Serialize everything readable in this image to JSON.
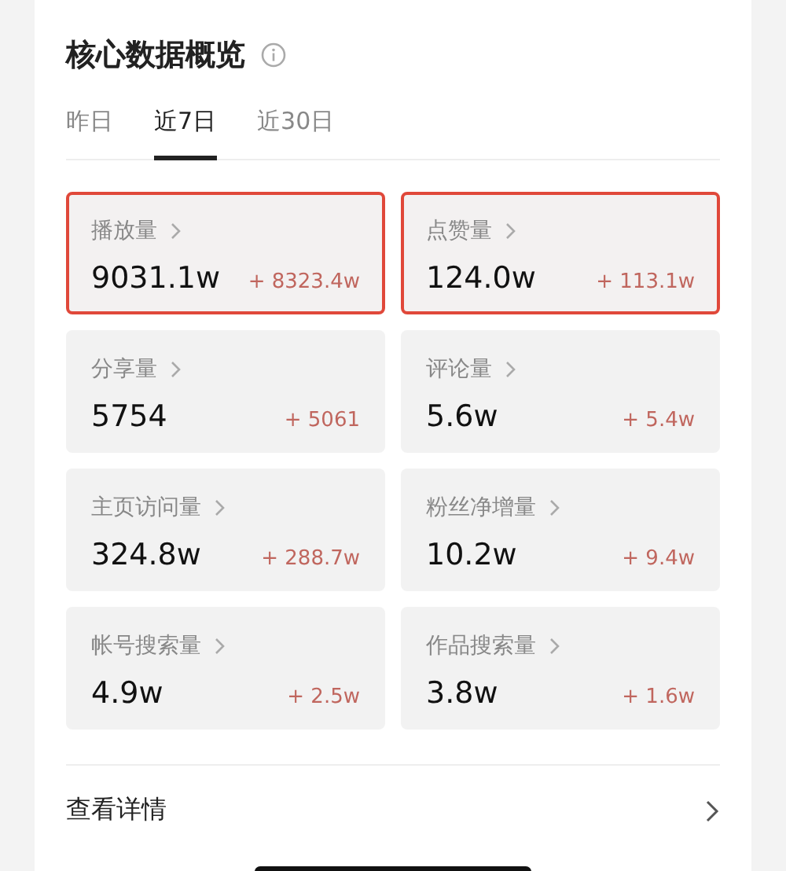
{
  "title": "核心数据概览",
  "tabs": [
    {
      "label": "昨日",
      "selected": false
    },
    {
      "label": "近7日",
      "selected": true
    },
    {
      "label": "近30日",
      "selected": false
    }
  ],
  "metrics": [
    {
      "label": "播放量",
      "value": "9031.1w",
      "change": "+ 8323.4w",
      "highlighted": true
    },
    {
      "label": "点赞量",
      "value": "124.0w",
      "change": "+ 113.1w",
      "highlighted": true
    },
    {
      "label": "分享量",
      "value": "5754",
      "change": "+ 5061",
      "highlighted": false
    },
    {
      "label": "评论量",
      "value": "5.6w",
      "change": "+ 5.4w",
      "highlighted": false
    },
    {
      "label": "主页访问量",
      "value": "324.8w",
      "change": "+ 288.7w",
      "highlighted": false
    },
    {
      "label": "粉丝净增量",
      "value": "10.2w",
      "change": "+ 9.4w",
      "highlighted": false
    },
    {
      "label": "帐号搜索量",
      "value": "4.9w",
      "change": "+ 2.5w",
      "highlighted": false
    },
    {
      "label": "作品搜索量",
      "value": "3.8w",
      "change": "+ 1.6w",
      "highlighted": false
    }
  ],
  "details_link": "查看详情"
}
